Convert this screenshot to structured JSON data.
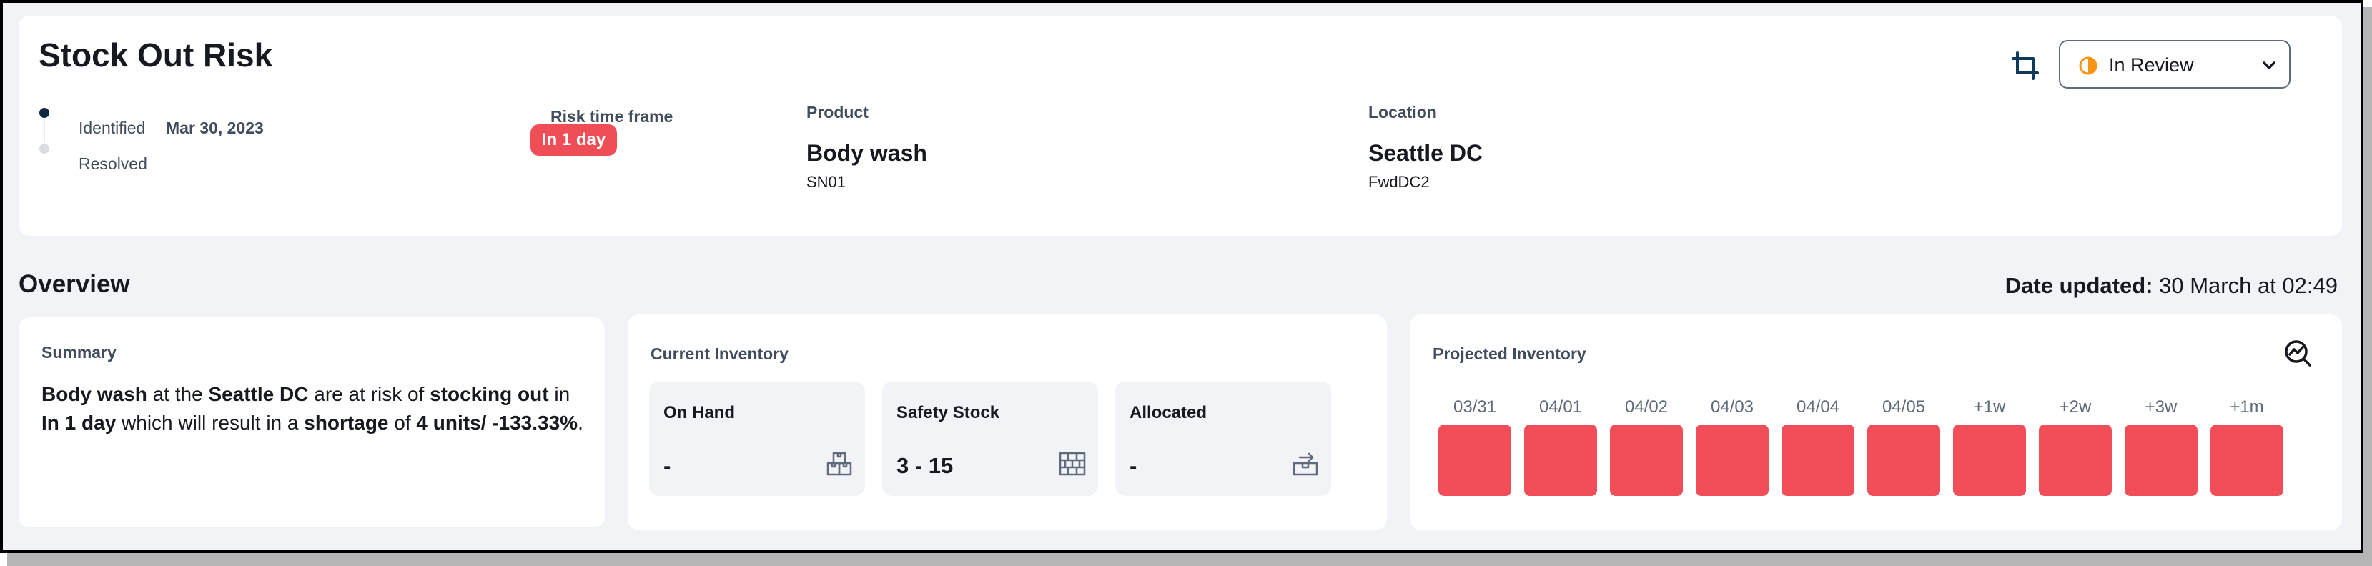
{
  "header": {
    "title": "Stock Out Risk",
    "timeline": [
      {
        "label": "Identified",
        "date": "Mar 30, 2023",
        "active": true
      },
      {
        "label": "Resolved",
        "date": "",
        "active": false
      }
    ],
    "risk_time_frame": {
      "label": "Risk time frame",
      "value": "In 1 day",
      "color": "#f04e57"
    },
    "product": {
      "label": "Product",
      "name": "Body wash",
      "code": "SN01"
    },
    "location": {
      "label": "Location",
      "name": "Seattle DC",
      "code": "FwdDC2"
    },
    "status": {
      "value": "In Review",
      "icon": "half-circle-icon",
      "icon_color": "#f89412"
    }
  },
  "overview": {
    "title": "Overview",
    "date_updated_label": "Date updated:",
    "date_updated_value": "30 March at 02:49"
  },
  "summary": {
    "label": "Summary",
    "text_parts": [
      {
        "text": "Body wash",
        "bold": true
      },
      {
        "text": " at the ",
        "bold": false
      },
      {
        "text": "Seattle DC",
        "bold": true
      },
      {
        "text": " are at risk of ",
        "bold": false
      },
      {
        "text": "stocking out",
        "bold": true
      },
      {
        "text": " in ",
        "bold": false
      },
      {
        "text": "In 1 day",
        "bold": true
      },
      {
        "text": " which will result in a ",
        "bold": false
      },
      {
        "text": "shortage",
        "bold": true
      },
      {
        "text": " of ",
        "bold": false
      },
      {
        "text": "4 units/ -133.33%",
        "bold": true
      },
      {
        "text": ".",
        "bold": false
      }
    ]
  },
  "current_inventory": {
    "label": "Current Inventory",
    "items": [
      {
        "title": "On Hand",
        "value": "-",
        "icon": "boxes-icon"
      },
      {
        "title": "Safety Stock",
        "value": "3 - 15",
        "icon": "pallet-stack-icon"
      },
      {
        "title": "Allocated",
        "value": "-",
        "icon": "box-transfer-icon"
      }
    ]
  },
  "projected_inventory": {
    "label": "Projected Inventory",
    "icon": "chart-search-icon",
    "bar_color": "#f24e59",
    "periods": [
      "03/31",
      "04/01",
      "04/02",
      "04/03",
      "04/04",
      "04/05",
      "+1w",
      "+2w",
      "+3w",
      "+1m"
    ]
  }
}
